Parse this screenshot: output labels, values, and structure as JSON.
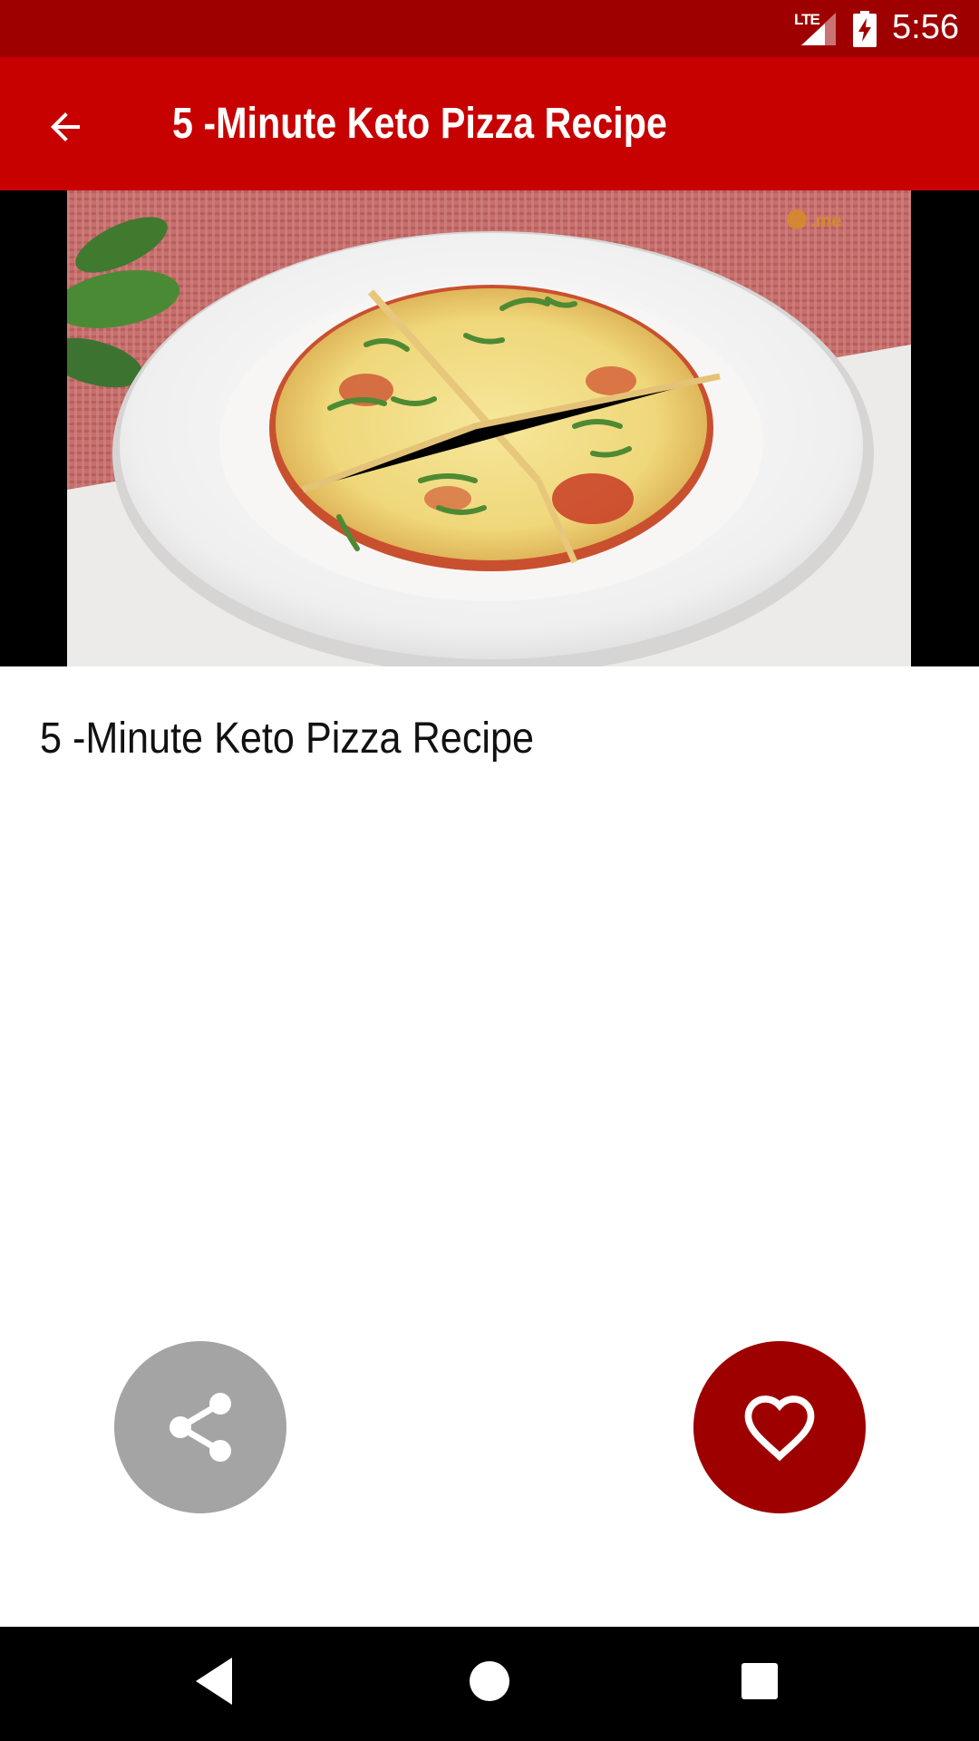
{
  "status_bar": {
    "network": "LTE",
    "time": "5:56",
    "icons": [
      "signal-icon",
      "battery-charging-icon"
    ]
  },
  "app_bar": {
    "title": "5 -Minute Keto Pizza Recipe",
    "back_icon": "arrow-back-icon"
  },
  "media": {
    "description": "video-thumbnail",
    "watermark": ".me"
  },
  "content": {
    "recipe_title": "5 -Minute Keto Pizza Recipe"
  },
  "actions": {
    "share_icon": "share-icon",
    "favorite_icon": "heart-icon"
  },
  "colors": {
    "status_bar": "#9e0000",
    "app_bar": "#c70000",
    "share_fab": "#a4a4a4",
    "favorite_fab": "#9e0000"
  },
  "nav_bar": {
    "icons": [
      "nav-back-icon",
      "nav-home-icon",
      "nav-recents-icon"
    ]
  }
}
